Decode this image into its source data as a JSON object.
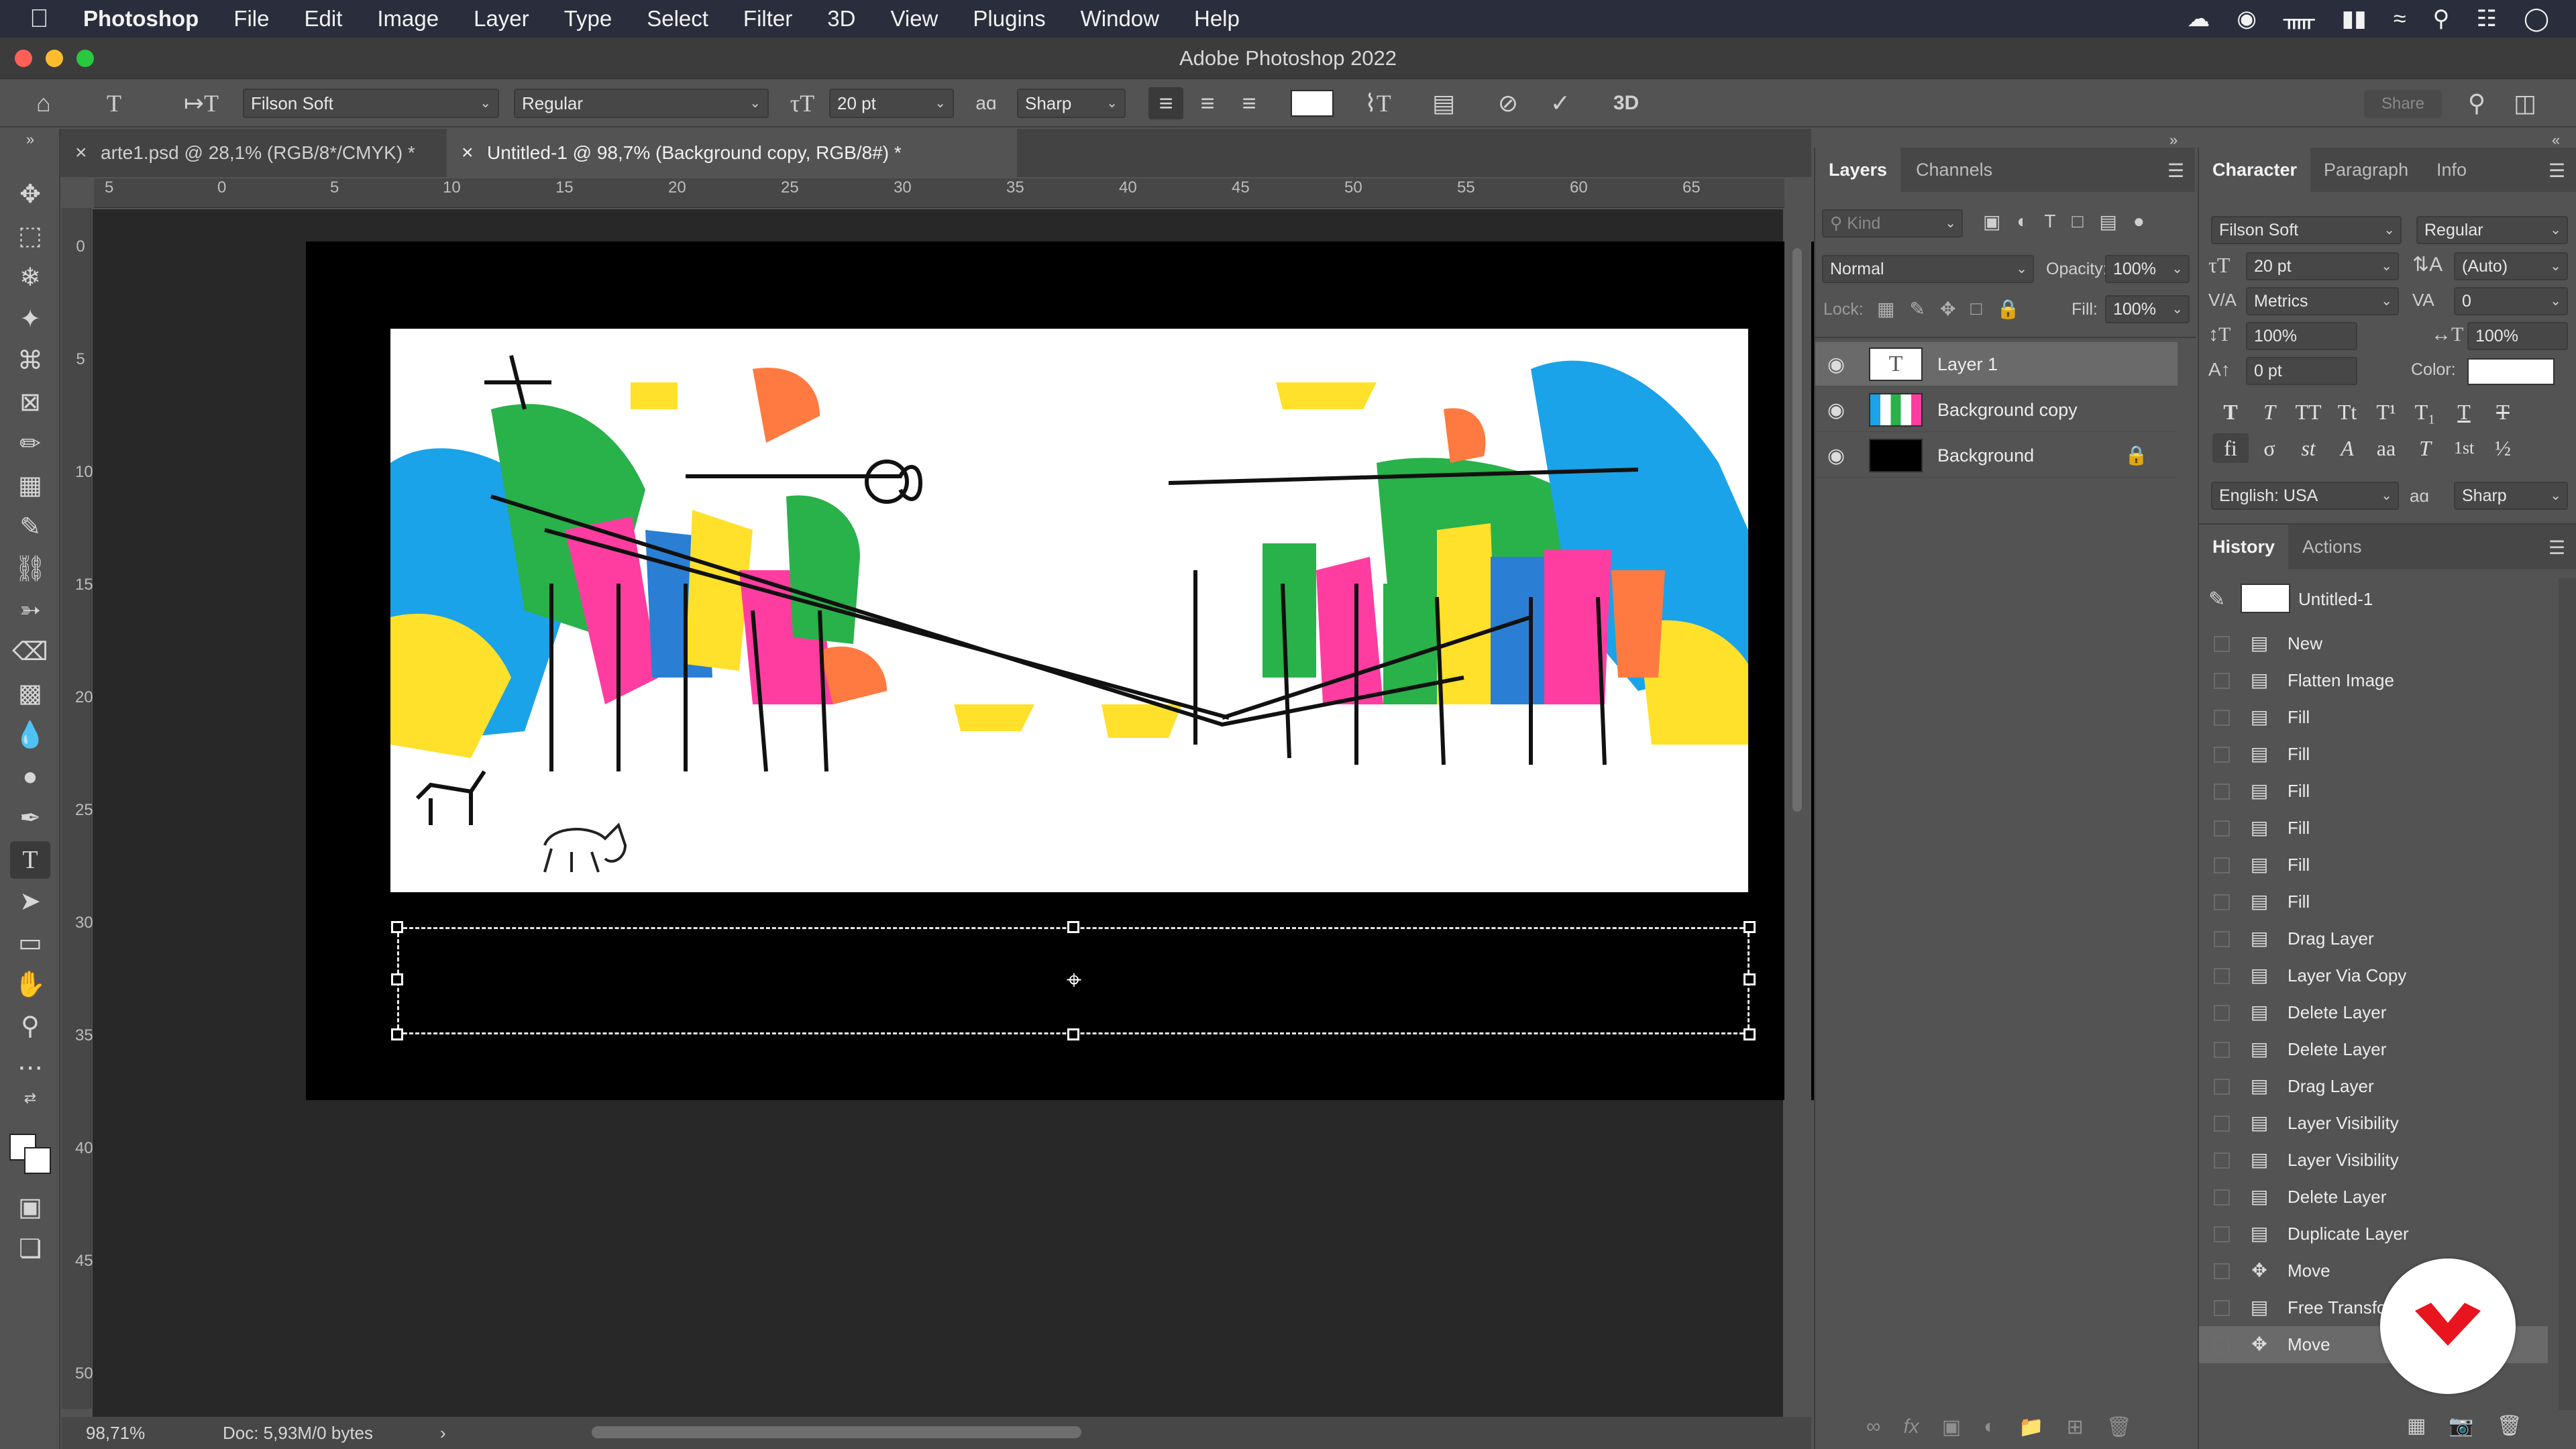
{
  "menubar": {
    "items": [
      "Photoshop",
      "File",
      "Edit",
      "Image",
      "Layer",
      "Type",
      "Select",
      "Filter",
      "3D",
      "View",
      "Plugins",
      "Window",
      "Help"
    ]
  },
  "window": {
    "title": "Adobe Photoshop 2022"
  },
  "options": {
    "font_family": "Filson Soft",
    "font_style": "Regular",
    "font_size": "20 pt",
    "antialias_glyph": "aɑ",
    "antialias": "Sharp",
    "share_label": "Share",
    "threed_label": "3D",
    "text_color": "#ffffff"
  },
  "tabs": [
    {
      "label": "arte1.psd @ 28,1% (RGB/8*/CMYK) *",
      "active": false
    },
    {
      "label": "Untitled-1 @ 98,7% (Background copy, RGB/8#) *",
      "active": true
    }
  ],
  "ruler": {
    "h": [
      "5",
      "0",
      "5",
      "10",
      "15",
      "20",
      "25",
      "30",
      "35",
      "40",
      "45",
      "50",
      "55",
      "60",
      "65"
    ],
    "v": [
      "0",
      "5",
      "10",
      "15",
      "20",
      "25",
      "30",
      "35",
      "40",
      "45",
      "50"
    ]
  },
  "status": {
    "zoom": "98,71%",
    "doc": "Doc: 5,93M/0 bytes",
    "arrow": "›"
  },
  "layers_panel": {
    "tabs": [
      "Layers",
      "Channels"
    ],
    "kind_placeholder": "Kind",
    "blend_mode": "Normal",
    "opacity_label": "Opacity:",
    "opacity": "100%",
    "lock_label": "Lock:",
    "fill_label": "Fill:",
    "fill": "100%",
    "layers": [
      {
        "name": "Layer 1",
        "type": "text",
        "selected": true
      },
      {
        "name": "Background copy",
        "type": "image",
        "selected": false
      },
      {
        "name": "Background",
        "type": "fill",
        "locked": true,
        "selected": false
      }
    ]
  },
  "character_panel": {
    "tabs": [
      "Character",
      "Paragraph",
      "Info"
    ],
    "font_family": "Filson Soft",
    "font_style": "Regular",
    "size": "20 pt",
    "leading": "(Auto)",
    "kerning": "Metrics",
    "tracking": "0",
    "vertical_scale": "100%",
    "horizontal_scale": "100%",
    "baseline_shift": "0 pt",
    "color_label": "Color:",
    "language": "English: USA",
    "antialias_glyph": "aɑ",
    "antialias": "Sharp",
    "style_buttons": [
      "T",
      "T",
      "TT",
      "Tt",
      "T¹",
      "T₁",
      "T",
      "T"
    ],
    "otf_buttons": [
      "fi",
      "σ",
      "st",
      "A",
      "aa",
      "T",
      "1st",
      "½"
    ]
  },
  "history_panel": {
    "tabs": [
      "History",
      "Actions"
    ],
    "snapshot": "Untitled-1",
    "items": [
      {
        "name": "New",
        "icon": "doc"
      },
      {
        "name": "Flatten Image",
        "icon": "doc"
      },
      {
        "name": "Fill",
        "icon": "doc"
      },
      {
        "name": "Fill",
        "icon": "doc"
      },
      {
        "name": "Fill",
        "icon": "doc"
      },
      {
        "name": "Fill",
        "icon": "doc"
      },
      {
        "name": "Fill",
        "icon": "doc"
      },
      {
        "name": "Fill",
        "icon": "doc"
      },
      {
        "name": "Drag Layer",
        "icon": "doc"
      },
      {
        "name": "Layer Via Copy",
        "icon": "doc"
      },
      {
        "name": "Delete Layer",
        "icon": "doc"
      },
      {
        "name": "Delete Layer",
        "icon": "doc"
      },
      {
        "name": "Drag Layer",
        "icon": "doc"
      },
      {
        "name": "Layer Visibility",
        "icon": "doc"
      },
      {
        "name": "Layer Visibility",
        "icon": "doc"
      },
      {
        "name": "Delete Layer",
        "icon": "doc"
      },
      {
        "name": "Duplicate Layer",
        "icon": "doc"
      },
      {
        "name": "Move",
        "icon": "move"
      },
      {
        "name": "Free Transform",
        "icon": "doc"
      },
      {
        "name": "Move",
        "icon": "move"
      }
    ]
  },
  "colors": {
    "menubar": "#2a2d3c",
    "panel": "#535353",
    "canvas_bg": "#282828",
    "brand": "#e8141e"
  }
}
